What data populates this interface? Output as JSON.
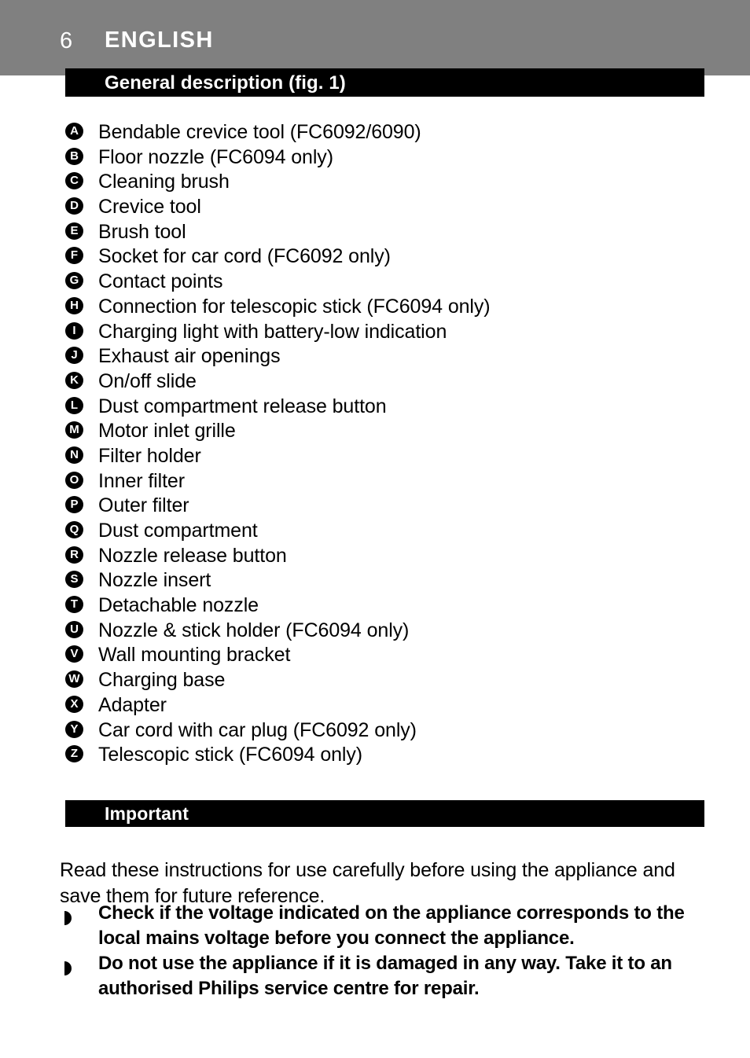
{
  "header": {
    "page_number": "6",
    "chapter_title": "ENGLISH",
    "band_color": "#808080",
    "text_color": "#ffffff"
  },
  "sections": {
    "general_description": {
      "bar_label": "General description (fig. 1)",
      "bar_color": "#000000",
      "bar_text_color": "#ffffff"
    },
    "important": {
      "bar_label": "Important",
      "bar_color": "#000000",
      "bar_text_color": "#ffffff"
    }
  },
  "parts_list": [
    {
      "letter": "A",
      "label": "Bendable crevice tool (FC6092/6090)"
    },
    {
      "letter": "B",
      "label": "Floor nozzle (FC6094 only)"
    },
    {
      "letter": "C",
      "label": "Cleaning brush"
    },
    {
      "letter": "D",
      "label": "Crevice tool"
    },
    {
      "letter": "E",
      "label": "Brush tool"
    },
    {
      "letter": "F",
      "label": "Socket for car cord (FC6092 only)"
    },
    {
      "letter": "G",
      "label": "Contact points"
    },
    {
      "letter": "H",
      "label": "Connection for telescopic stick (FC6094 only)"
    },
    {
      "letter": "I",
      "label": "Charging light with battery-low indication"
    },
    {
      "letter": "J",
      "label": "Exhaust air openings"
    },
    {
      "letter": "K",
      "label": "On/off slide"
    },
    {
      "letter": "L",
      "label": "Dust compartment release button"
    },
    {
      "letter": "M",
      "label": "Motor inlet grille"
    },
    {
      "letter": "N",
      "label": "Filter holder"
    },
    {
      "letter": "O",
      "label": "Inner filter"
    },
    {
      "letter": "P",
      "label": "Outer filter"
    },
    {
      "letter": "Q",
      "label": "Dust compartment"
    },
    {
      "letter": "R",
      "label": "Nozzle release button"
    },
    {
      "letter": "S",
      "label": "Nozzle insert"
    },
    {
      "letter": "T",
      "label": "Detachable nozzle"
    },
    {
      "letter": "U",
      "label": "Nozzle & stick holder (FC6094 only)"
    },
    {
      "letter": "V",
      "label": "Wall mounting bracket"
    },
    {
      "letter": "W",
      "label": "Charging base"
    },
    {
      "letter": "X",
      "label": "Adapter"
    },
    {
      "letter": "Y",
      "label": "Car cord with car plug (FC6092 only)"
    },
    {
      "letter": "Z",
      "label": "Telescopic stick (FC6094 only)"
    }
  ],
  "important_body": {
    "intro": "Read these instructions for use carefully before using the appliance and save them for future reference.",
    "warnings": [
      "Check if the voltage indicated on the appliance corresponds to the local mains voltage before you connect the appliance.",
      "Do not use the appliance if it is damaged in any way. Take it to an authorised Philips service centre for repair."
    ]
  }
}
